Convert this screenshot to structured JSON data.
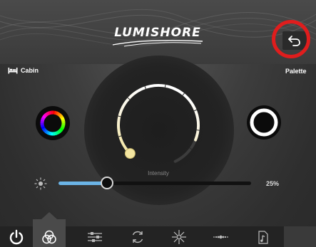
{
  "header": {
    "brand_name": "LUMISHORE",
    "back_icon": "back-arrow-icon"
  },
  "zone": {
    "icon": "bed-icon",
    "label": "Cabin"
  },
  "palette": {
    "label": "Palette"
  },
  "intensity": {
    "label": "Intensity",
    "value_text": "25%",
    "value": 0.25,
    "dial_fraction": 0.85
  },
  "colors": {
    "slider_fill": "#6bb4e6",
    "dial_warm": "#f3e5a0",
    "highlight_ring": "#e01d1d"
  },
  "tabs": [
    {
      "name": "power-icon",
      "active": false
    },
    {
      "name": "color-mix-icon",
      "active": true
    },
    {
      "name": "sliders-icon",
      "active": false
    },
    {
      "name": "cycle-icon",
      "active": false
    },
    {
      "name": "sparkle-icon",
      "active": false
    },
    {
      "name": "pulse-icon",
      "active": false
    },
    {
      "name": "music-icon",
      "active": false
    }
  ]
}
